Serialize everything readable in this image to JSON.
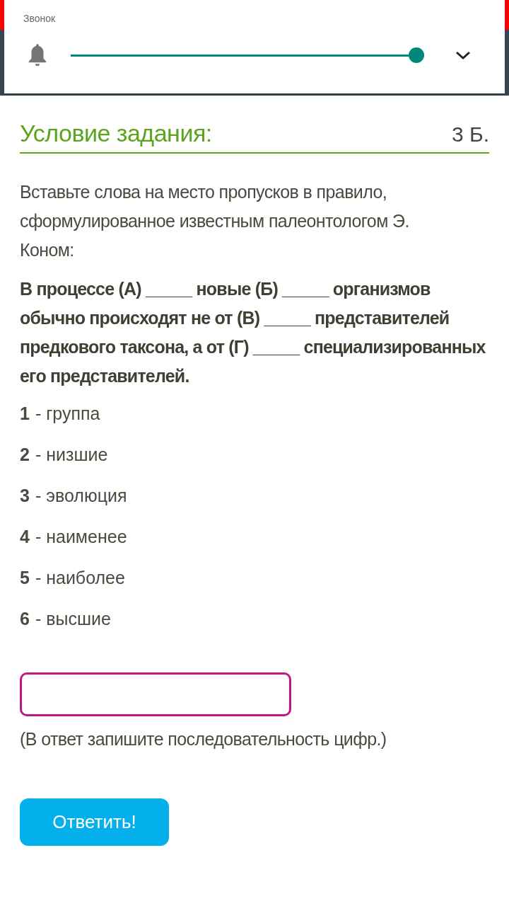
{
  "notification": {
    "label": "Звонок",
    "volume": {
      "level": 1
    }
  },
  "task": {
    "title": "Условие задания:",
    "points": "3 Б.",
    "intro": "Вставьте слова на место пропусков в правило, сформулированное известным палеонтологом Э. Коном:",
    "statement": "В процессе (А) _____ новые (Б) _____ организмов обычно происходят не от (В) _____ представителей предкового таксона, а от (Г) _____ специализированных его представителей.",
    "options": [
      {
        "number": "1",
        "text": "- группа"
      },
      {
        "number": "2",
        "text": "- низшие"
      },
      {
        "number": "3",
        "text": "- эволюция"
      },
      {
        "number": "4",
        "text": "- наименее"
      },
      {
        "number": "5",
        "text": "- наиболее"
      },
      {
        "number": "6",
        "text": "- высшие"
      }
    ],
    "hint": "(В ответ запишите последовательность цифр.)",
    "submit": "Ответить!"
  }
}
